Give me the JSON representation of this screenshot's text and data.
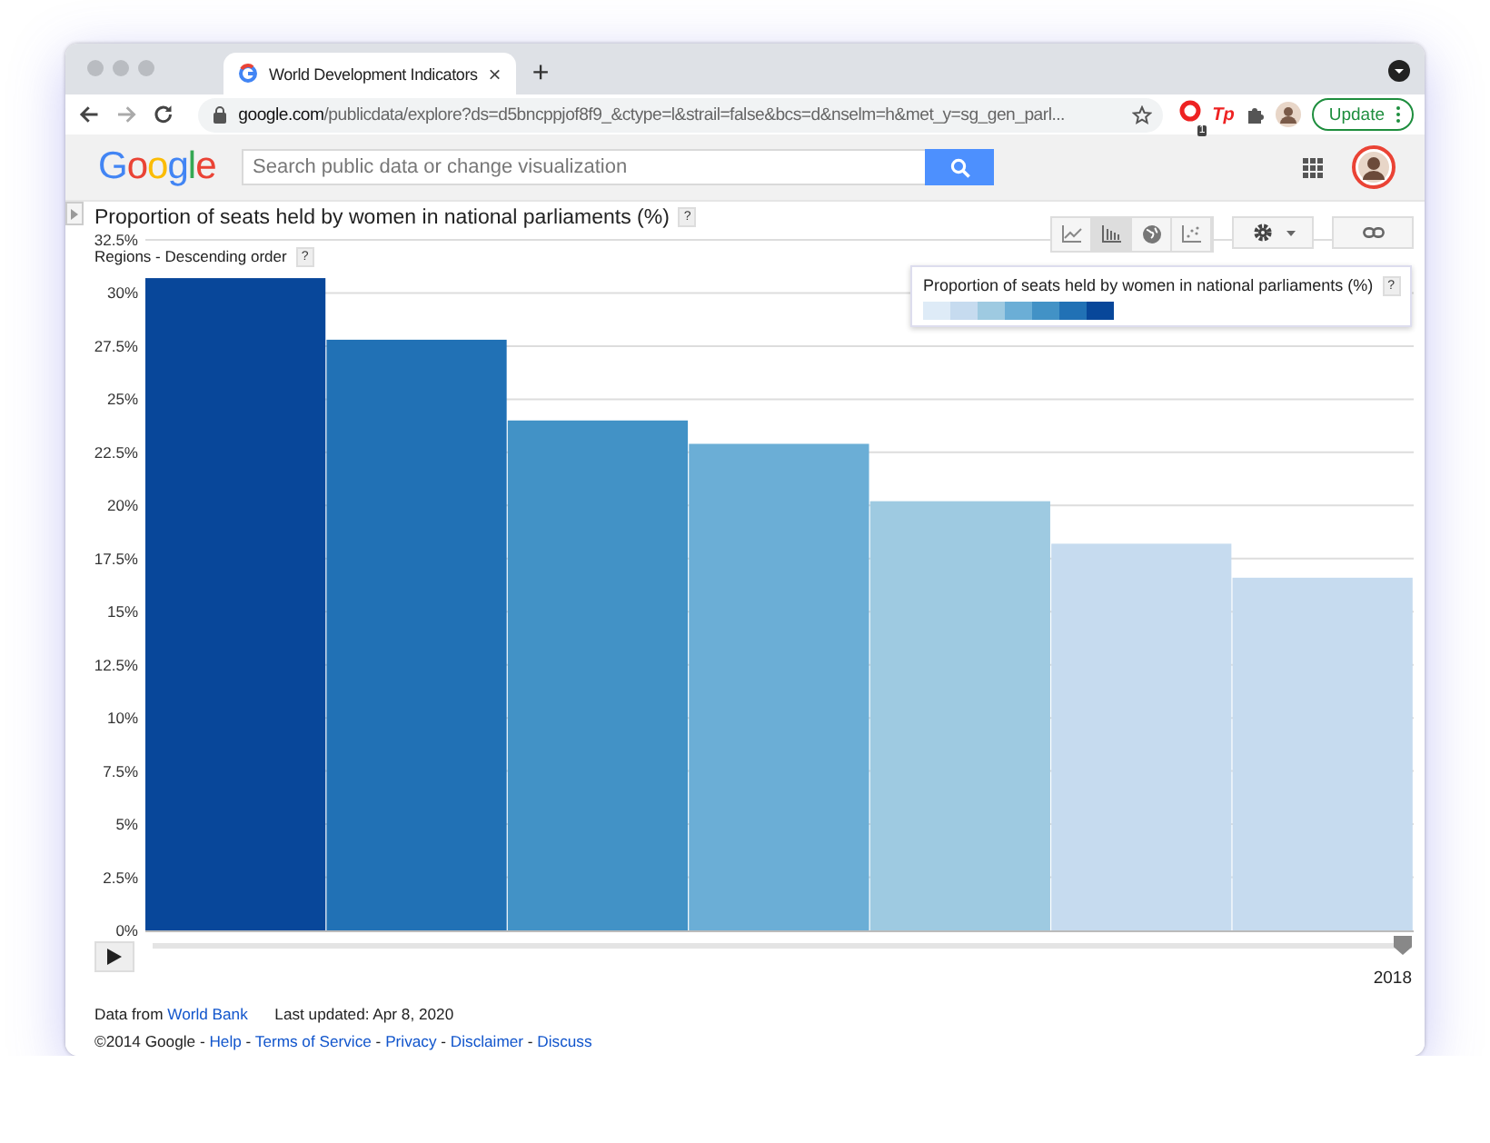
{
  "browser": {
    "tab_title": "World Development Indicators",
    "tab_close": "×",
    "new_tab": "+",
    "address_host": "google.com",
    "address_path": "/publicdata/explore?ds=d5bncppjof8f9_&ctype=l&strail=false&bcs=d&nselm=h&met_y=sg_gen_parl...",
    "extension_badge": "1",
    "extension_tp": "Tp",
    "update_button": "Update"
  },
  "header": {
    "logo": "Google",
    "search": {
      "placeholder": "Search public data or change visualization"
    }
  },
  "chart_types": [
    {
      "kind": "line",
      "selected": false
    },
    {
      "kind": "bar",
      "selected": true
    },
    {
      "kind": "map",
      "selected": false
    },
    {
      "kind": "scatter",
      "selected": false
    }
  ],
  "title": "Proportion of seats held by women in national parliaments (%)",
  "title_help": "?",
  "subtitle": "Regions - Descending order",
  "subtitle_help": "?",
  "legend": {
    "title": "Proportion of seats held by women in national parliaments (%)",
    "help": "?",
    "swatches": [
      {
        "color": "#deebf7"
      },
      {
        "color": "#c6dbef"
      },
      {
        "color": "#9ecae1"
      },
      {
        "color": "#6baed6"
      },
      {
        "color": "#4292c6"
      },
      {
        "color": "#2171b5"
      },
      {
        "color": "#08479a"
      }
    ]
  },
  "chart_data": {
    "type": "bar",
    "grid": true,
    "ylim": [
      0,
      32.5
    ],
    "yticks": [
      {
        "value": 0,
        "label": "0%"
      },
      {
        "value": 2.5,
        "label": "2.5%"
      },
      {
        "value": 5,
        "label": "5%"
      },
      {
        "value": 7.5,
        "label": "7.5%"
      },
      {
        "value": 10,
        "label": "10%"
      },
      {
        "value": 12.5,
        "label": "12.5%"
      },
      {
        "value": 15,
        "label": "15%"
      },
      {
        "value": 17.5,
        "label": "17.5%"
      },
      {
        "value": 20,
        "label": "20%"
      },
      {
        "value": 22.5,
        "label": "22.5%"
      },
      {
        "value": 25,
        "label": "25%"
      },
      {
        "value": 27.5,
        "label": "27.5%"
      },
      {
        "value": 30,
        "label": "30%"
      },
      {
        "value": 32.5,
        "label": "32.5%"
      }
    ],
    "values": [
      30.7,
      27.8,
      24.0,
      22.9,
      20.2,
      18.2,
      16.6
    ]
  },
  "timeline": {
    "level": 1,
    "year": "2018"
  },
  "footer": {
    "line1": [
      {
        "kind": "text",
        "text": "Data from"
      },
      {
        "kind": "link",
        "text": "World Bank"
      },
      {
        "kind": "gap"
      },
      {
        "kind": "text",
        "text": "Last updated: Apr 8, 2020"
      }
    ],
    "line2": [
      {
        "kind": "text",
        "text": "©2014 Google"
      },
      {
        "kind": "sep",
        "text": "-"
      },
      {
        "kind": "link",
        "text": "Help"
      },
      {
        "kind": "sep",
        "text": "-"
      },
      {
        "kind": "link",
        "text": "Terms of Service"
      },
      {
        "kind": "sep",
        "text": "-"
      },
      {
        "kind": "link",
        "text": "Privacy"
      },
      {
        "kind": "sep",
        "text": "-"
      },
      {
        "kind": "link",
        "text": "Disclaimer"
      },
      {
        "kind": "sep",
        "text": "-"
      },
      {
        "kind": "link",
        "text": "Discuss"
      }
    ]
  }
}
